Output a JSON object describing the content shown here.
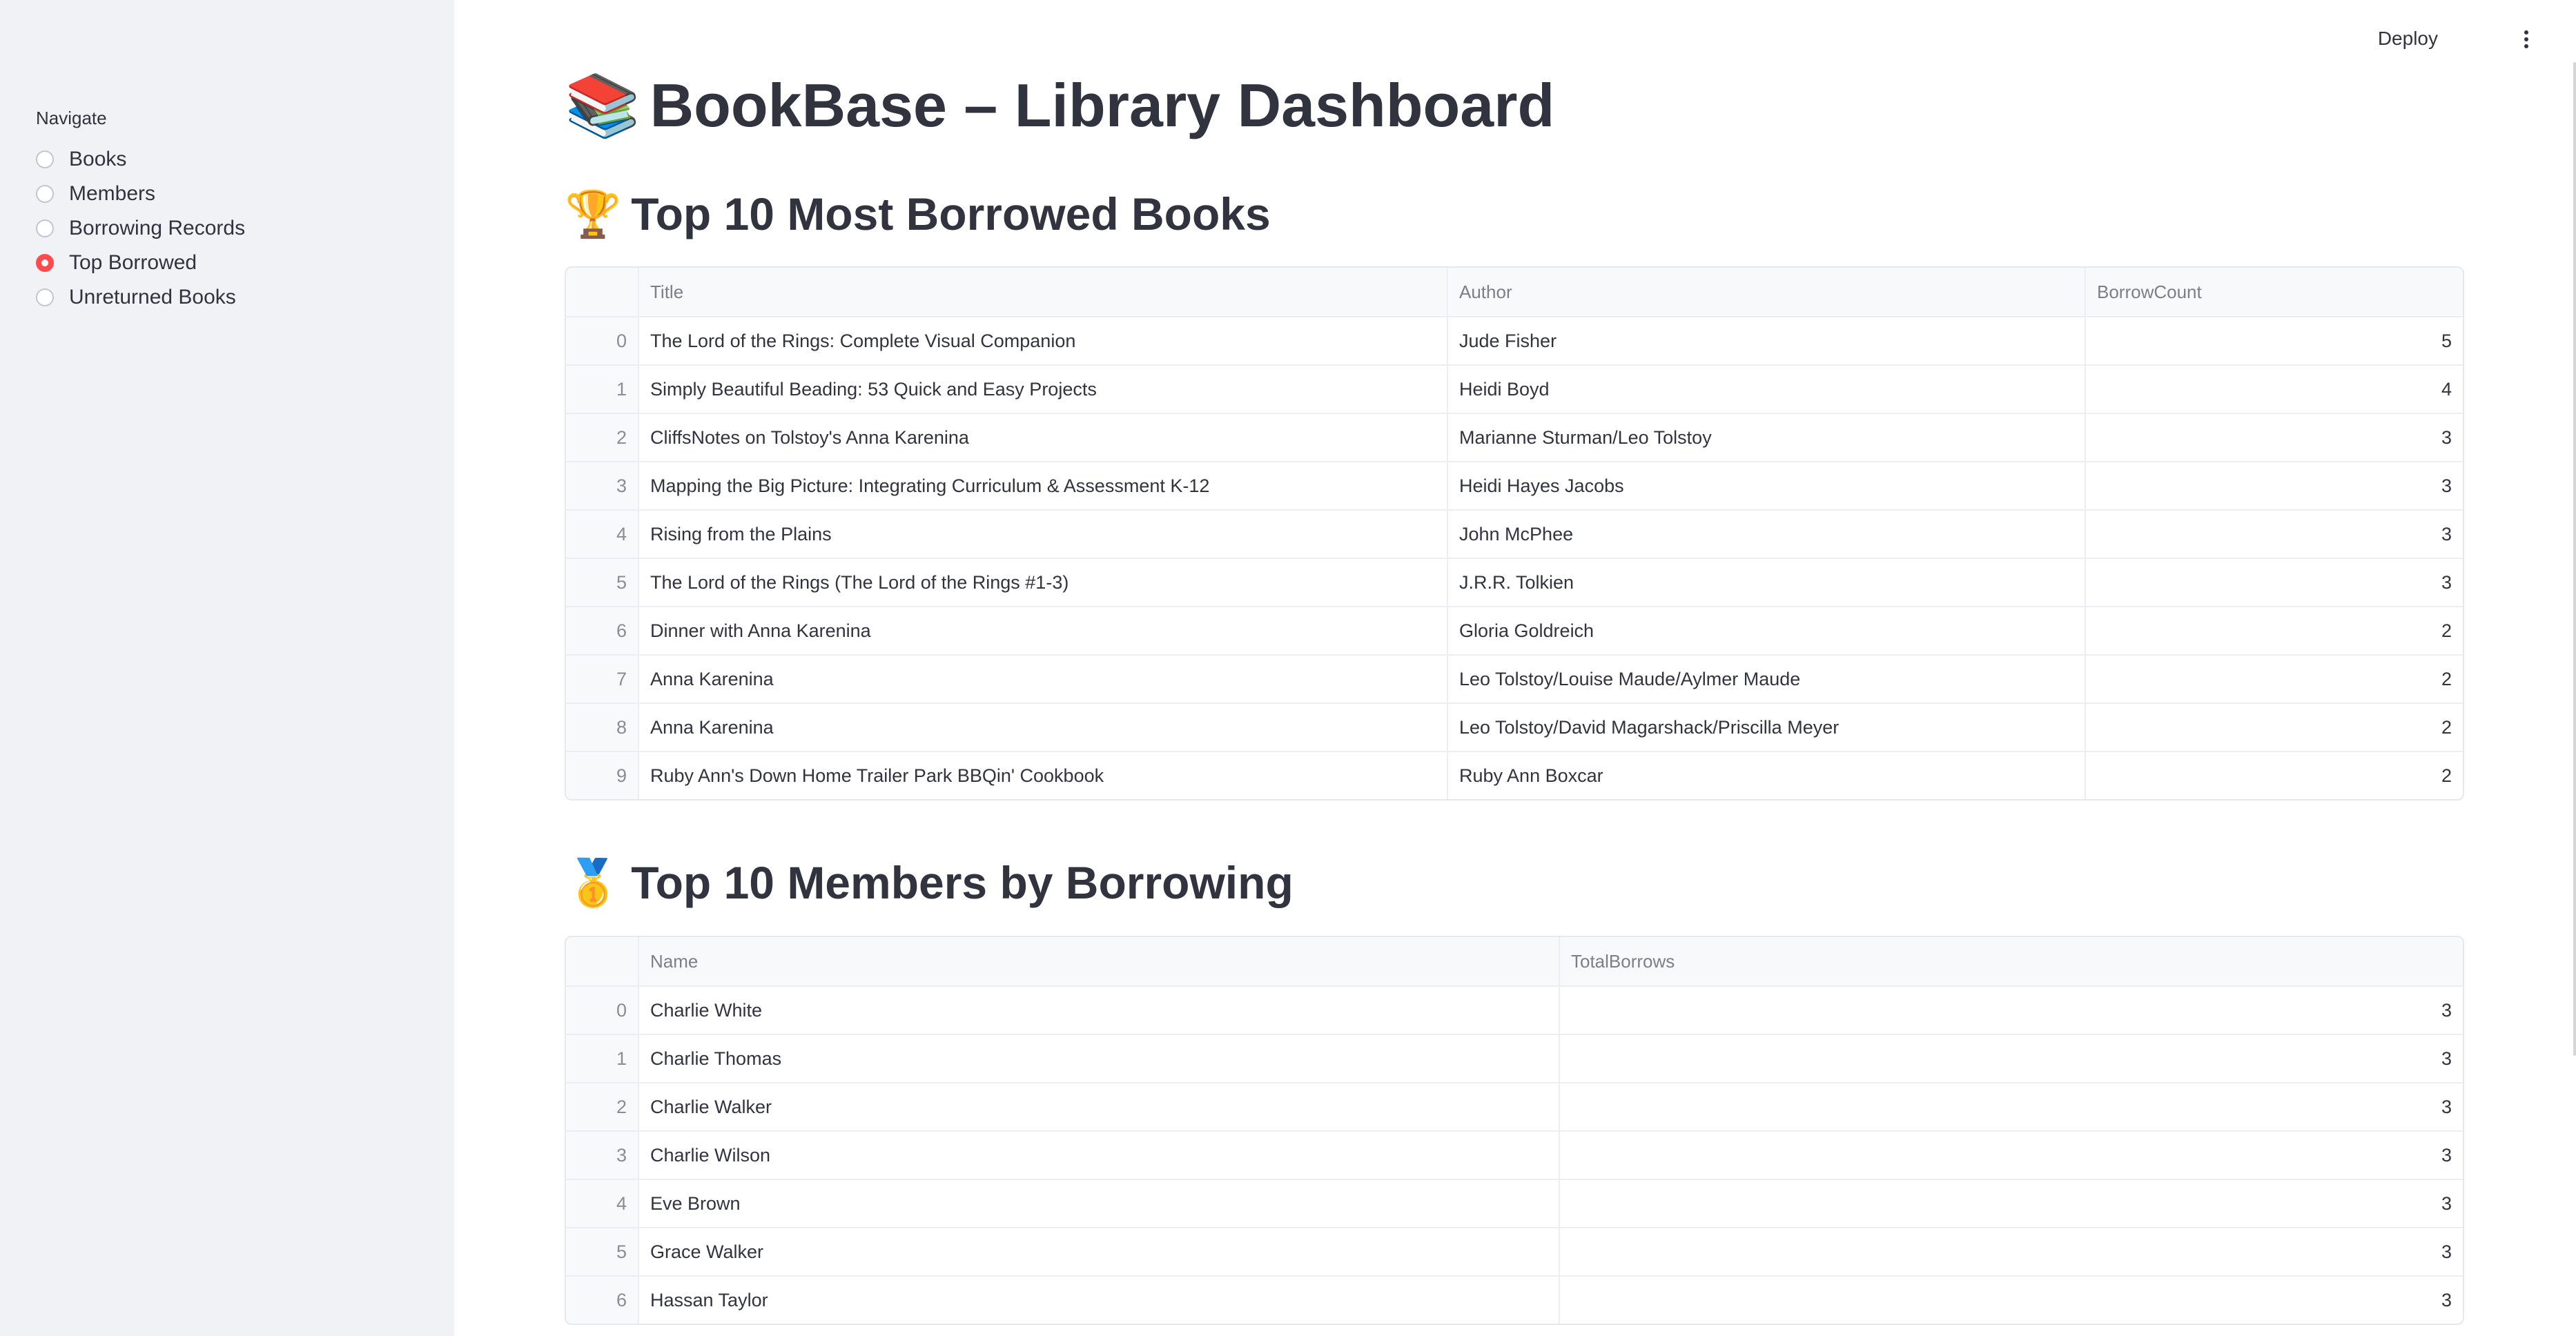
{
  "header": {
    "deploy_label": "Deploy",
    "menu_icon": "kebab-menu-icon"
  },
  "sidebar": {
    "label": "Navigate",
    "items": [
      {
        "label": "Books",
        "selected": false
      },
      {
        "label": "Members",
        "selected": false
      },
      {
        "label": "Borrowing Records",
        "selected": false
      },
      {
        "label": "Top Borrowed",
        "selected": true
      },
      {
        "label": "Unreturned Books",
        "selected": false
      }
    ],
    "accent_color": "#ff4b4b"
  },
  "main": {
    "title_emoji": "📚",
    "title": "BookBase – Library Dashboard",
    "books_section": {
      "emoji": "🏆",
      "title": "Top 10 Most Borrowed Books",
      "columns": [
        "",
        "Title",
        "Author",
        "BorrowCount"
      ],
      "rows": [
        {
          "index": "0",
          "title": "The Lord of the Rings: Complete Visual Companion",
          "author": "Jude Fisher",
          "count": "5"
        },
        {
          "index": "1",
          "title": "Simply Beautiful Beading: 53 Quick and Easy Projects",
          "author": "Heidi Boyd",
          "count": "4"
        },
        {
          "index": "2",
          "title": "CliffsNotes on Tolstoy's Anna Karenina",
          "author": "Marianne Sturman/Leo Tolstoy",
          "count": "3"
        },
        {
          "index": "3",
          "title": "Mapping the Big Picture: Integrating Curriculum & Assessment K-12",
          "author": "Heidi Hayes Jacobs",
          "count": "3"
        },
        {
          "index": "4",
          "title": "Rising from the Plains",
          "author": "John McPhee",
          "count": "3"
        },
        {
          "index": "5",
          "title": "The Lord of the Rings (The Lord of the Rings  #1-3)",
          "author": "J.R.R. Tolkien",
          "count": "3"
        },
        {
          "index": "6",
          "title": "Dinner with Anna Karenina",
          "author": "Gloria Goldreich",
          "count": "2"
        },
        {
          "index": "7",
          "title": "Anna Karenina",
          "author": "Leo Tolstoy/Louise Maude/Aylmer Maude",
          "count": "2"
        },
        {
          "index": "8",
          "title": "Anna Karenina",
          "author": "Leo Tolstoy/David Magarshack/Priscilla Meyer",
          "count": "2"
        },
        {
          "index": "9",
          "title": "Ruby Ann's Down Home Trailer Park BBQin' Cookbook",
          "author": "Ruby Ann Boxcar",
          "count": "2"
        }
      ]
    },
    "members_section": {
      "emoji": "🥇",
      "title": "Top 10 Members by Borrowing",
      "columns": [
        "",
        "Name",
        "TotalBorrows"
      ],
      "rows": [
        {
          "index": "0",
          "name": "Charlie White",
          "total": "3"
        },
        {
          "index": "1",
          "name": "Charlie Thomas",
          "total": "3"
        },
        {
          "index": "2",
          "name": "Charlie Walker",
          "total": "3"
        },
        {
          "index": "3",
          "name": "Charlie Wilson",
          "total": "3"
        },
        {
          "index": "4",
          "name": "Eve Brown",
          "total": "3"
        },
        {
          "index": "5",
          "name": "Grace Walker",
          "total": "3"
        },
        {
          "index": "6",
          "name": "Hassan Taylor",
          "total": "3"
        }
      ]
    }
  }
}
